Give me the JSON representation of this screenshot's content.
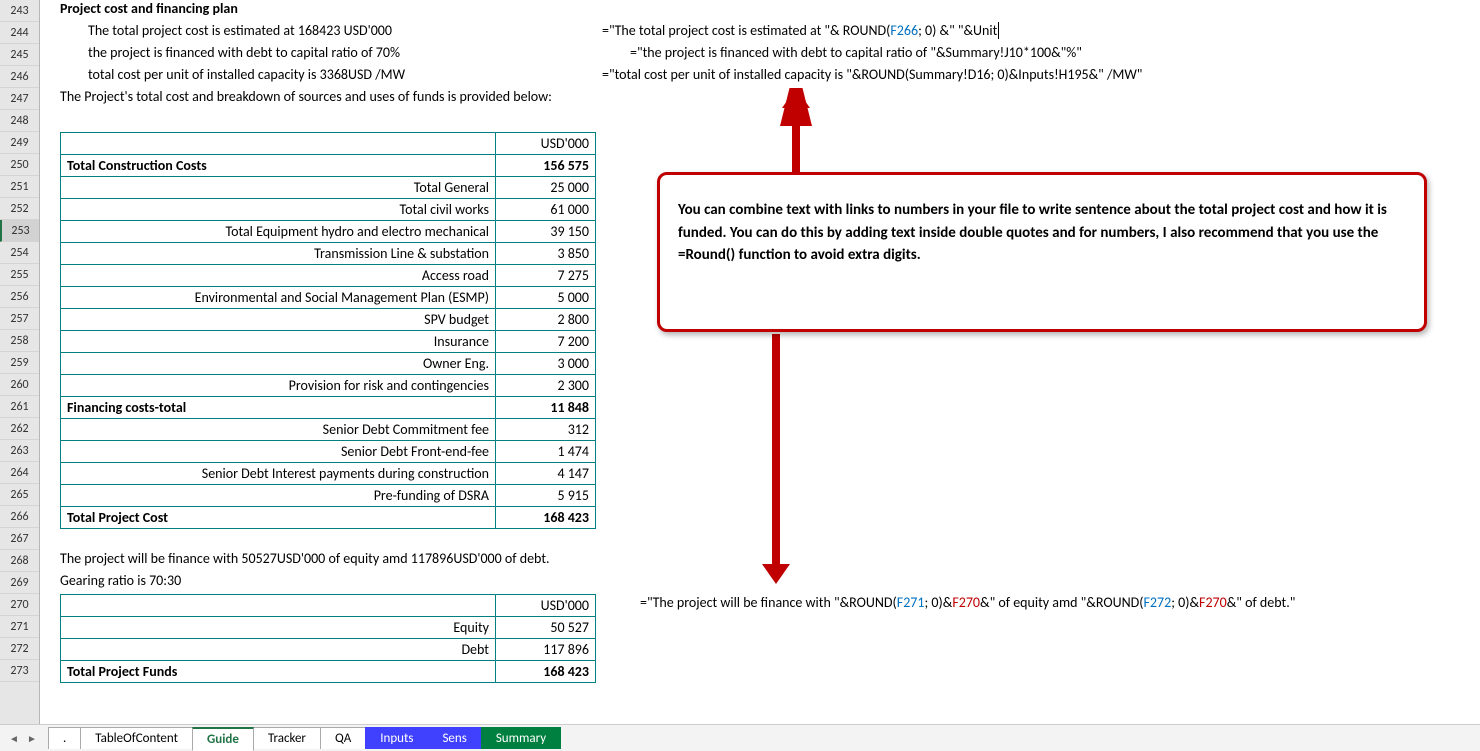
{
  "rows": [
    243,
    244,
    245,
    246,
    247,
    248,
    249,
    250,
    251,
    252,
    253,
    254,
    255,
    256,
    257,
    258,
    259,
    260,
    261,
    262,
    263,
    264,
    265,
    266,
    267,
    268,
    269,
    270,
    271,
    272,
    273
  ],
  "selected_row": 253,
  "heading": "Project cost and financing plan",
  "narrative": {
    "l1": "The total project cost is estimated at 168423 USD'000",
    "l2": "the project is financed with debt to capital ratio of 70%",
    "l3": "total cost per unit of installed capacity is  3368USD /MW",
    "l4": "The Project's total cost and breakdown of sources and uses of funds is provided below:",
    "l5": "The project will be finance with 50527USD'000 of equity amd 117896USD'000 of debt.",
    "l6": "Gearing ratio is 70:30"
  },
  "formulas": {
    "f1": {
      "p1": "=\"The total project cost is estimated at \"& ROUND(",
      "ref1": "F266",
      "p2": "; 0) &\" \"&Unit"
    },
    "f2": "=\"the project is financed with debt to capital ratio of \"&Summary!J10*100&\"%\"",
    "f3": "=\"total cost per unit of installed capacity is  \"&ROUND(Summary!D16; 0)&Inputs!H195&\" /MW\"",
    "f4": {
      "p1": "=\"The project will be finance with \"&ROUND(",
      "ref1": "F271",
      "p2": "; 0)&",
      "ref2": "F270",
      "p3": "&\" of equity amd \"&ROUND(",
      "ref3": "F272",
      "p4": "; 0)&",
      "ref4": "F270",
      "p5": "&\" of debt.\""
    }
  },
  "table1": {
    "header_unit": "USD'000",
    "rows": [
      {
        "label": "Total Construction Costs",
        "value": "156 575",
        "bold": true
      },
      {
        "label": "Total General",
        "value": "25 000"
      },
      {
        "label": "Total civil works",
        "value": "61 000"
      },
      {
        "label": "Total Equipment hydro and electro mechanical",
        "value": "39 150"
      },
      {
        "label": "Transmission Line & substation",
        "value": "3 850"
      },
      {
        "label": "Access road",
        "value": "7 275"
      },
      {
        "label": "Environmental and Social Management Plan (ESMP)",
        "value": "5 000"
      },
      {
        "label": "SPV budget",
        "value": "2 800"
      },
      {
        "label": "Insurance",
        "value": "7 200"
      },
      {
        "label": "Owner Eng.",
        "value": "3 000"
      },
      {
        "label": "Provision for risk and contingencies",
        "value": "2 300"
      },
      {
        "label": "Financing costs-total",
        "value": "11 848",
        "bold": true
      },
      {
        "label": "Senior Debt  Commitment fee",
        "value": "312"
      },
      {
        "label": "Senior Debt  Front-end-fee",
        "value": "1 474"
      },
      {
        "label": "Senior Debt  Interest payments during construction",
        "value": "4 147"
      },
      {
        "label": "Pre-funding of DSRA",
        "value": "5 915"
      },
      {
        "label": "Total Project Cost",
        "value": "168 423",
        "bold": true
      }
    ]
  },
  "table2": {
    "header_unit": "USD'000",
    "rows": [
      {
        "label": "Equity",
        "value": "50 527"
      },
      {
        "label": "Debt",
        "value": "117 896"
      },
      {
        "label": "Total Project Funds",
        "value": "168 423",
        "bold": true
      }
    ]
  },
  "callout_text": "You can combine text with links to numbers in your file to write sentence about the total project cost and how it is funded. You can do this by adding text inside double quotes and for numbers, I also recommend that you use the =Round() function to avoid extra digits.",
  "tabs": {
    "dot": ".",
    "toc": "TableOfContent",
    "guide": "Guide",
    "tracker": "Tracker",
    "qa": "QA",
    "inputs": "Inputs",
    "sens": "Sens",
    "summary": "Summary"
  }
}
